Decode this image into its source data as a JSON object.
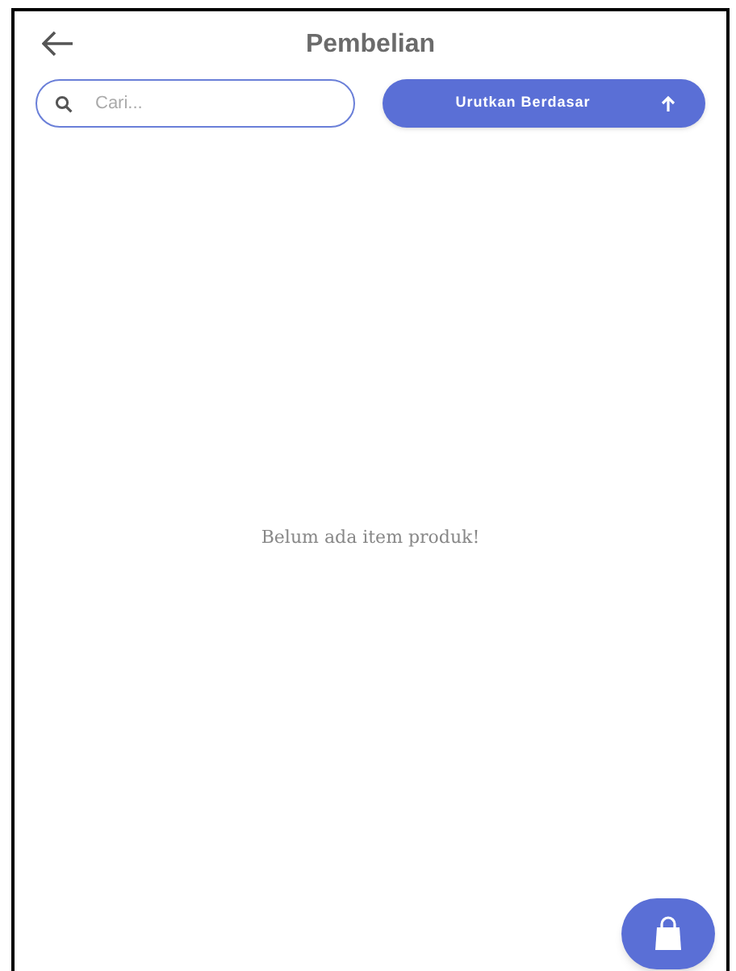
{
  "header": {
    "title": "Pembelian"
  },
  "search": {
    "placeholder": "Cari..."
  },
  "sort_button": {
    "label": "Urutkan Berdasar",
    "ascending": true
  },
  "empty_message": "Belum ada item produk!"
}
